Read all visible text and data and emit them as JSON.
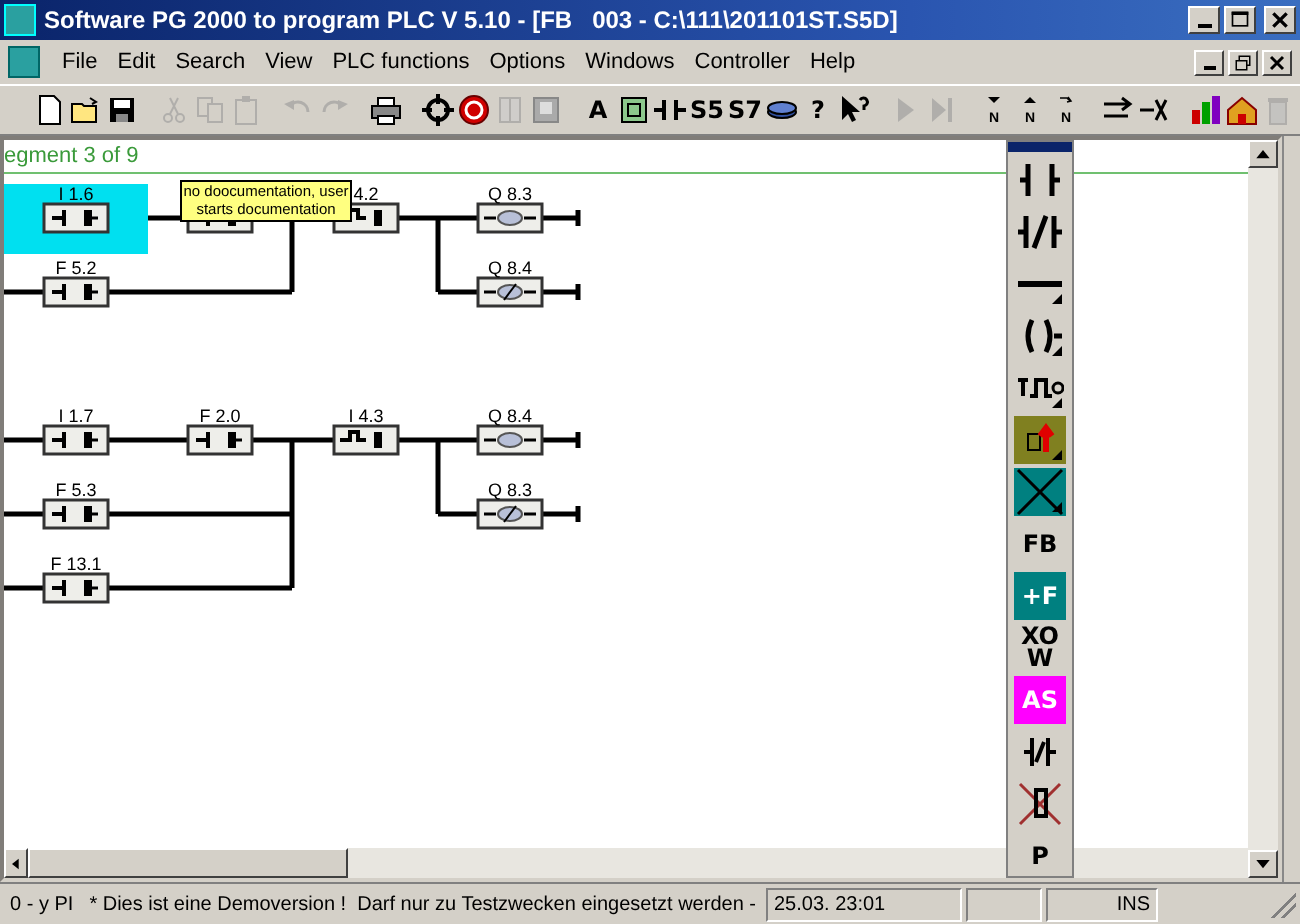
{
  "window": {
    "title": "Software PG 2000 to program PLC V 5.10 - [FB   003 - C:\\111\\201101ST.S5D]"
  },
  "menu": [
    "File",
    "Edit",
    "Search",
    "View",
    "PLC functions",
    "Options",
    "Windows",
    "Controller",
    "Help"
  ],
  "toolbar": [
    {
      "kind": "new",
      "disabled": false
    },
    {
      "kind": "open",
      "disabled": false
    },
    {
      "kind": "save",
      "disabled": false
    },
    {
      "kind": "sep"
    },
    {
      "kind": "cut",
      "disabled": true
    },
    {
      "kind": "copy",
      "disabled": true
    },
    {
      "kind": "paste",
      "disabled": true
    },
    {
      "kind": "sep"
    },
    {
      "kind": "undo",
      "disabled": true
    },
    {
      "kind": "redo",
      "disabled": true
    },
    {
      "kind": "sep"
    },
    {
      "kind": "print",
      "disabled": false
    },
    {
      "kind": "sep"
    },
    {
      "kind": "target",
      "disabled": false
    },
    {
      "kind": "stop",
      "disabled": false
    },
    {
      "kind": "doc",
      "disabled": true
    },
    {
      "kind": "frame",
      "disabled": false
    },
    {
      "kind": "sep"
    },
    {
      "kind": "text",
      "label": "A",
      "disabled": false
    },
    {
      "kind": "block",
      "disabled": false
    },
    {
      "kind": "contact",
      "disabled": false
    },
    {
      "kind": "text",
      "label": "S5",
      "disabled": false
    },
    {
      "kind": "text",
      "label": "S7",
      "disabled": false
    },
    {
      "kind": "disk",
      "disabled": false
    },
    {
      "kind": "text",
      "label": "?",
      "disabled": false
    },
    {
      "kind": "pointer",
      "disabled": false
    },
    {
      "kind": "sep"
    },
    {
      "kind": "play",
      "disabled": true
    },
    {
      "kind": "step",
      "disabled": true
    },
    {
      "kind": "sep"
    },
    {
      "kind": "down",
      "label": "N",
      "disabled": false
    },
    {
      "kind": "up",
      "label": "N",
      "disabled": false
    },
    {
      "kind": "skip",
      "label": "N",
      "disabled": false
    },
    {
      "kind": "sep"
    },
    {
      "kind": "nright",
      "disabled": false
    },
    {
      "kind": "nx",
      "disabled": false
    },
    {
      "kind": "sep"
    },
    {
      "kind": "chart",
      "disabled": false
    },
    {
      "kind": "house",
      "disabled": false
    },
    {
      "kind": "bin",
      "disabled": true
    }
  ],
  "segment": {
    "title": "egment 3 of 9"
  },
  "networks": [
    {
      "parallel": [
        [
          {
            "kind": "contact",
            "label": "I 1.6",
            "selected": true
          },
          {
            "kind": "contact",
            "selected": false
          }
        ],
        [
          {
            "kind": "contact",
            "label": "F 5.2",
            "selected": false
          }
        ]
      ],
      "series": [
        {
          "kind": "edge_contact",
          "label": "4.2",
          "selected": false
        }
      ],
      "outputs": [
        {
          "kind": "coil",
          "label": "Q 8.3",
          "selected": false
        },
        {
          "kind": "coil_flag",
          "label": "Q 8.4",
          "selected": false
        }
      ]
    },
    {
      "parallel": [
        [
          {
            "kind": "contact",
            "label": "I 1.7",
            "selected": false
          },
          {
            "kind": "contact",
            "label": "F 2.0",
            "selected": false
          }
        ],
        [
          {
            "kind": "contact",
            "label": "F 5.3",
            "selected": false
          }
        ],
        [
          {
            "kind": "contact",
            "label": "F 13.1",
            "selected": false
          }
        ]
      ],
      "series": [
        {
          "kind": "edge_contact",
          "label": "I 4.3",
          "selected": false
        }
      ],
      "outputs": [
        {
          "kind": "coil",
          "label": "Q 8.4",
          "selected": false
        },
        {
          "kind": "coil_flag",
          "label": "Q 8.3",
          "selected": false
        }
      ]
    }
  ],
  "tooltip": {
    "lines": [
      "no doocumentation, user",
      "starts documentation"
    ]
  },
  "palette": [
    {
      "kind": "no_contact"
    },
    {
      "kind": "nc_contact"
    },
    {
      "kind": "wire"
    },
    {
      "kind": "coil"
    },
    {
      "kind": "pulse"
    },
    {
      "kind": "compare",
      "color": "#808020"
    },
    {
      "kind": "cross",
      "color": "#008080"
    },
    {
      "kind": "text",
      "label": "FB"
    },
    {
      "kind": "text",
      "label": "+F",
      "color": "#008080"
    },
    {
      "kind": "text",
      "label": "XO W"
    },
    {
      "kind": "text",
      "label": "AS",
      "color": "#ff00ff"
    },
    {
      "kind": "slash_coil"
    },
    {
      "kind": "cross_coil"
    },
    {
      "kind": "text",
      "label": "P"
    }
  ],
  "status_bar": [
    "0 - y PI",
    "* Dies ist eine Demoversion !  Darf nur zu Testzwecken eingesetzt werden -",
    "25.03. 23:01",
    "INS"
  ]
}
